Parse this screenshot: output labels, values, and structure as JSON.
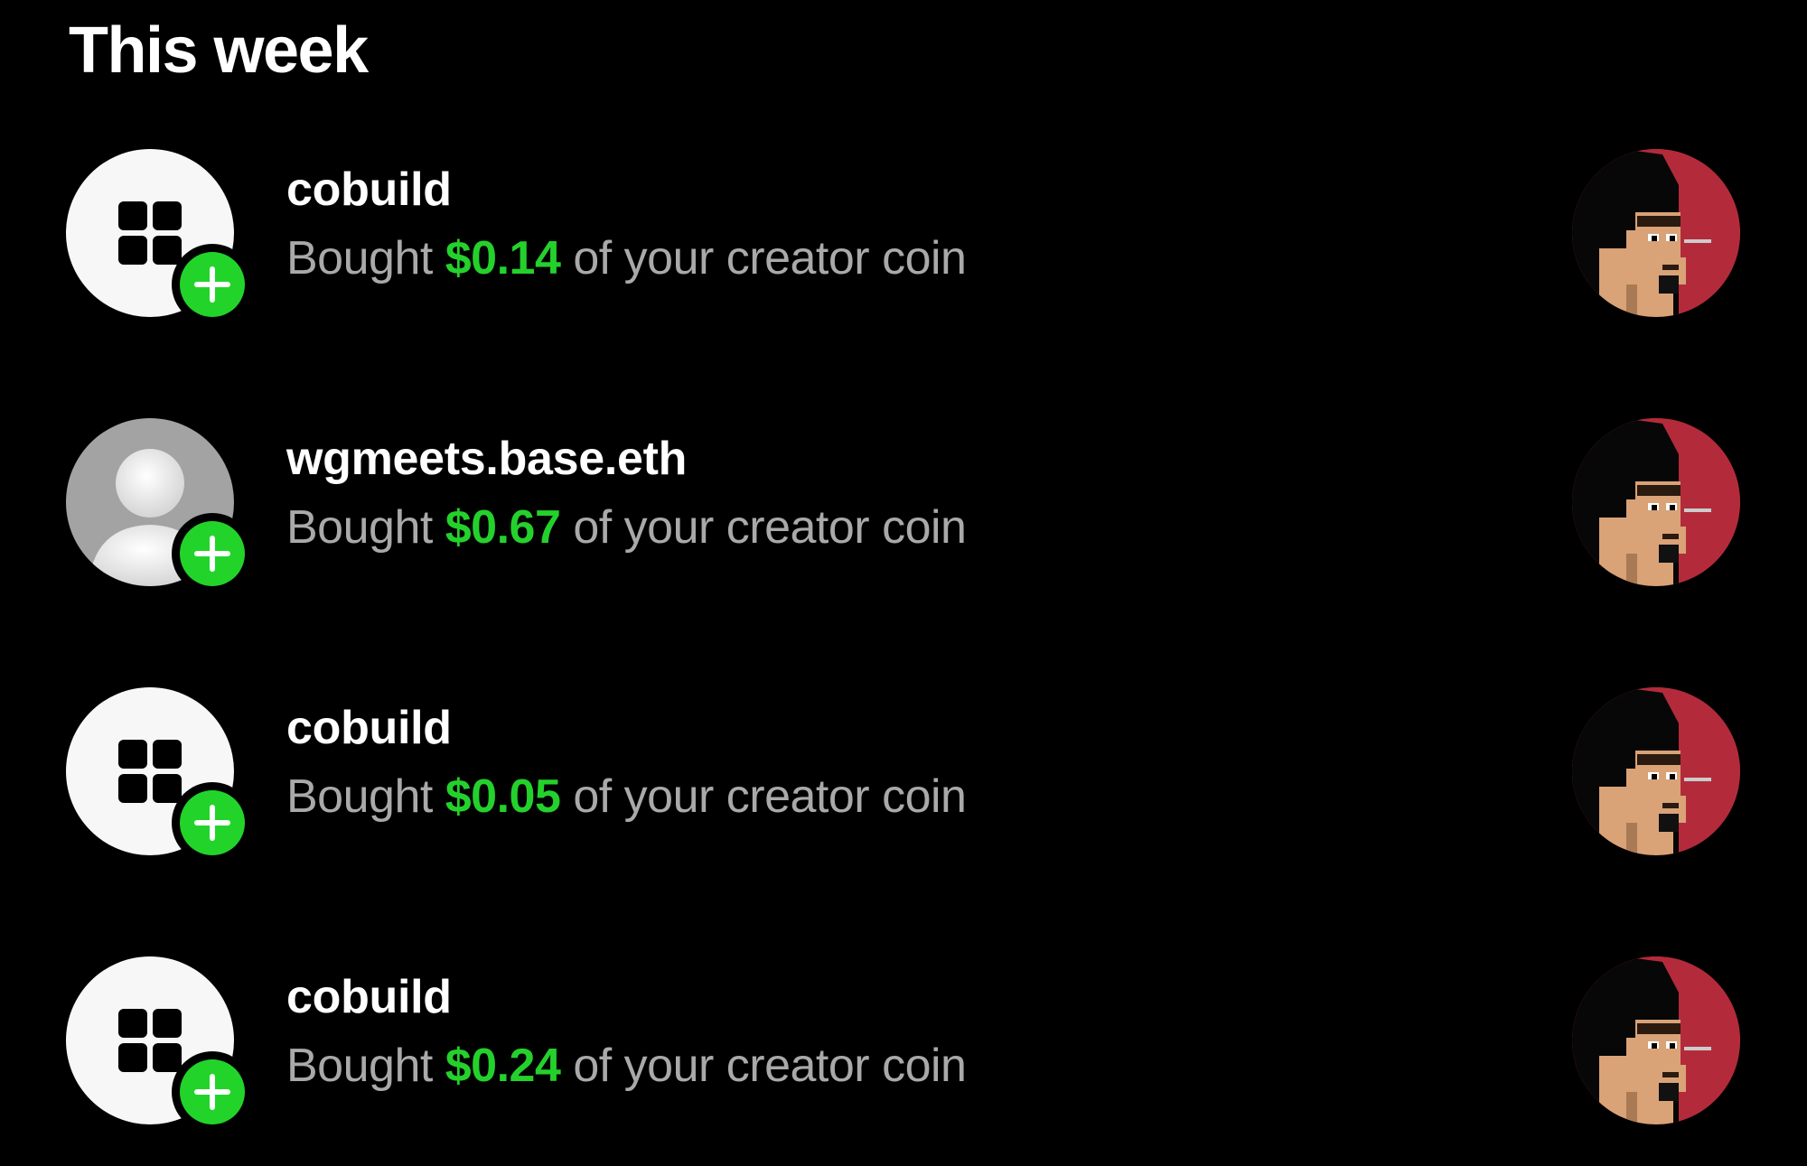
{
  "header": {
    "title": "This week"
  },
  "activities": [
    {
      "name": "cobuild",
      "avatar_icon": "grid-logo-icon",
      "prefix": "Bought",
      "amount": "$0.14",
      "suffix": "of your creator coin",
      "coin_icon": "pixel-punk-avatar-icon"
    },
    {
      "name": "wgmeets.base.eth",
      "avatar_icon": "default-person-icon",
      "prefix": "Bought",
      "amount": "$0.67",
      "suffix": "of your creator coin",
      "coin_icon": "pixel-punk-avatar-icon"
    },
    {
      "name": "cobuild",
      "avatar_icon": "grid-logo-icon",
      "prefix": "Bought",
      "amount": "$0.05",
      "suffix": "of your creator coin",
      "coin_icon": "pixel-punk-avatar-icon"
    },
    {
      "name": "cobuild",
      "avatar_icon": "grid-logo-icon",
      "prefix": "Bought",
      "amount": "$0.24",
      "suffix": "of your creator coin",
      "coin_icon": "pixel-punk-avatar-icon"
    }
  ],
  "colors": {
    "background": "#000000",
    "amount_green": "#24d12c",
    "badge_green": "#22d42a",
    "secondary_text": "#a9a9a9",
    "coin_red": "#b32b3b"
  }
}
